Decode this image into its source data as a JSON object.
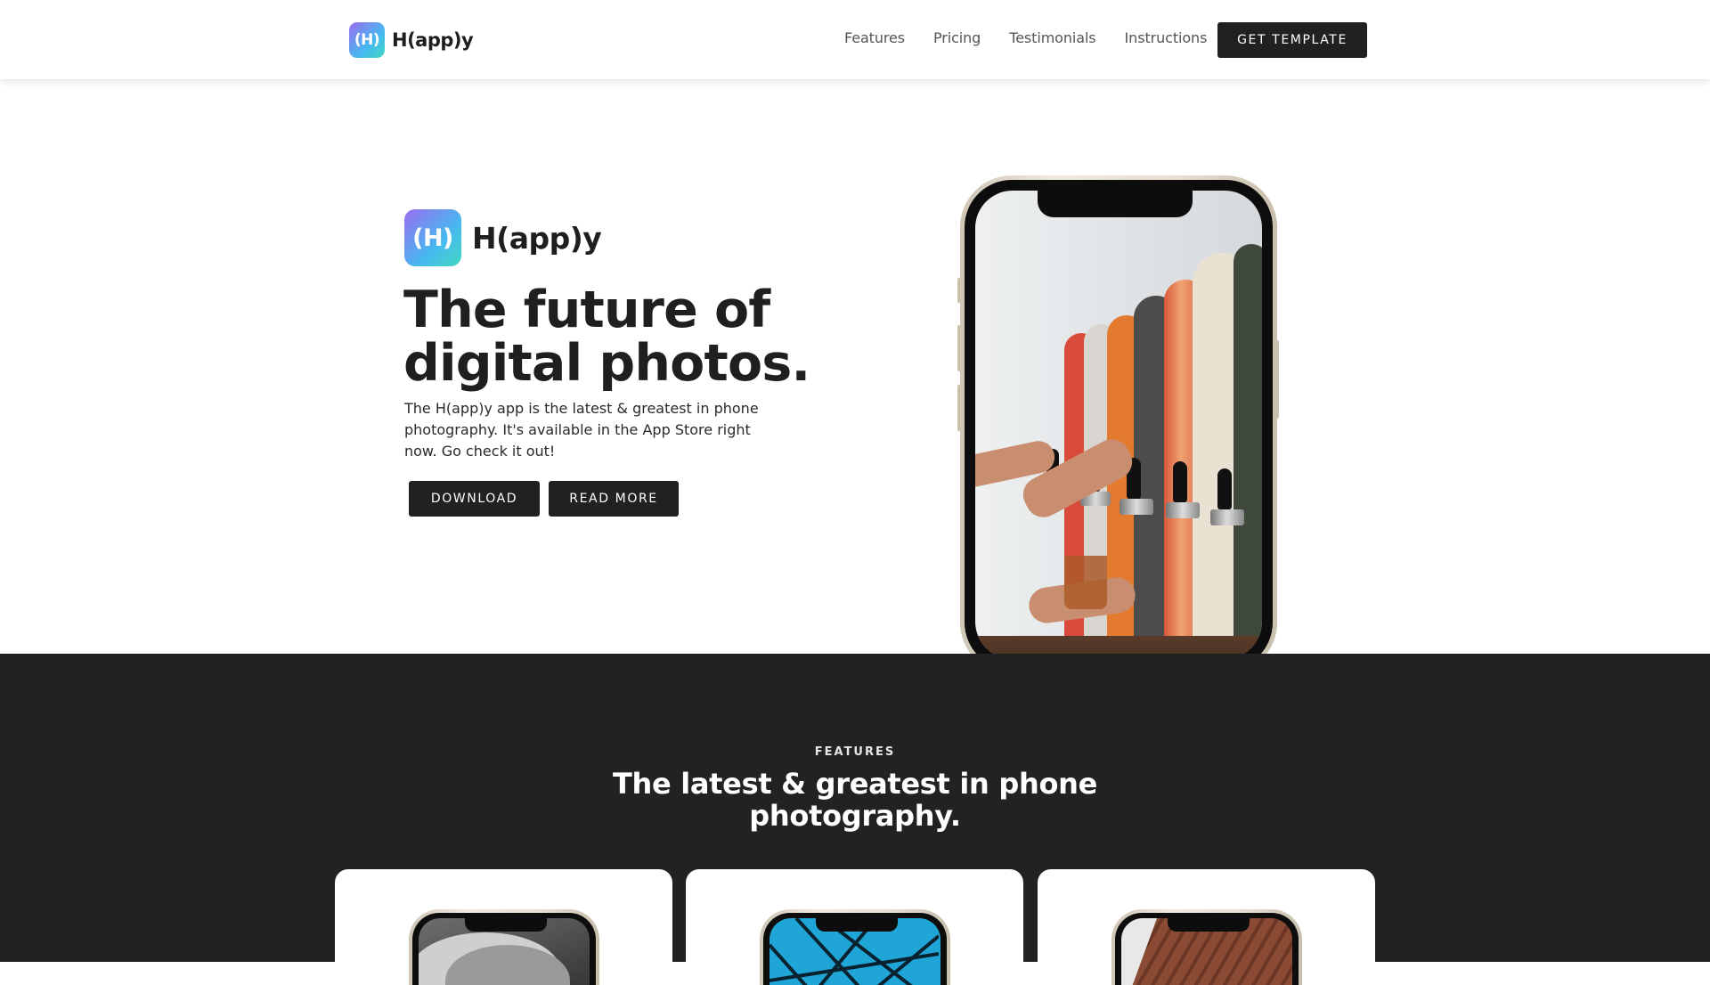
{
  "header": {
    "logo_badge": "(H)",
    "logo_text": "H(app)y",
    "nav": [
      "Features",
      "Pricing",
      "Testimonials",
      "Instructions"
    ],
    "cta": "GET TEMPLATE"
  },
  "hero": {
    "logo_badge": "(H)",
    "logo_text": "H(app)y",
    "title": "The future of digital photos.",
    "description": "The H(app)y app is the latest & greatest in phone photography. It's available in the App Store right now. Go check it out!",
    "download": "DOWNLOAD",
    "read_more": "READ MORE"
  },
  "features": {
    "label": "FEATURES",
    "title": "The latest & greatest in phone photography."
  },
  "colors": {
    "dark": "#212121",
    "section_bg": "#222222",
    "gradient_start": "#9b6cf0",
    "gradient_end": "#3fd8c4"
  }
}
